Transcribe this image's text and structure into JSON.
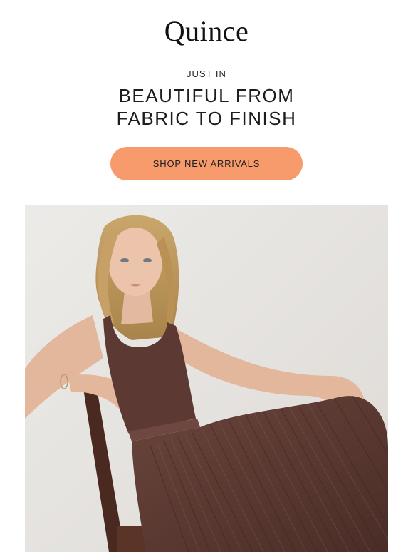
{
  "header": {
    "logo_text": "Quince"
  },
  "hero_copy": {
    "eyebrow": "JUST IN",
    "headline_line1": "BEAUTIFUL FROM",
    "headline_line2": "FABRIC TO FINISH"
  },
  "cta": {
    "label": "SHOP NEW ARRIVALS"
  },
  "colors": {
    "cta_background": "#f79a6c",
    "photo_backdrop": "#e8e5e2",
    "garment": "#5c3a33"
  }
}
